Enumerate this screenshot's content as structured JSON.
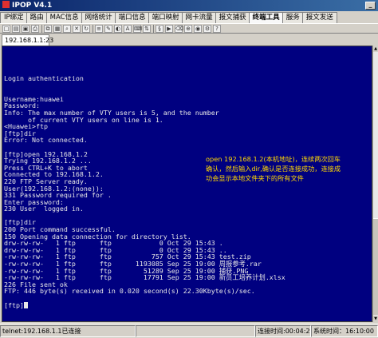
{
  "window": {
    "title": "IPOP V4.1"
  },
  "tabs": [
    {
      "label": "IP绑定"
    },
    {
      "label": "路由"
    },
    {
      "label": "MAC信息"
    },
    {
      "label": "网络统计"
    },
    {
      "label": "端口信息"
    },
    {
      "label": "端口映射"
    },
    {
      "label": "网卡流量"
    },
    {
      "label": "报文捕获"
    },
    {
      "label": "终端工具"
    },
    {
      "label": "服务"
    },
    {
      "label": "报文发送"
    }
  ],
  "toolbar": {
    "icons": [
      "new-session-icon",
      "open-icon",
      "save-icon",
      "print-icon",
      "copy-icon",
      "paste-icon",
      "find-icon",
      "disconnect-icon",
      "reconnect-icon",
      "properties-icon",
      "log-icon",
      "color-icon",
      "font-icon",
      "keymap-icon",
      "transfer-icon",
      "script-icon",
      "macro-icon",
      "clear-icon",
      "zoom-icon",
      "capture-icon",
      "options-icon",
      "help-icon"
    ]
  },
  "session": {
    "tab_label": "192.168.1.1:23"
  },
  "terminal": {
    "lines": [
      "Login authentication",
      "",
      "",
      "Username:huawei",
      "Password:",
      "Info: The max number of VTY users is 5, and the number",
      "      of current VTY users on line is 1.",
      "<Huawei>ftp",
      "[ftp]dir",
      "Error: Not connected.",
      "",
      "[ftp]open 192.168.1.2",
      "Trying 192.168.1.2 ...",
      "Press CTRL+K to abort",
      "Connected to 192.168.1.2.",
      "220 FTP Server ready.",
      "User(192.168.1.2:(none)):",
      "331 Password required for .",
      "Enter password:",
      "230 User  logged in.",
      "",
      "[ftp]dir",
      "200 Port command successful.",
      "150 Opening data connection for directory list.",
      "drw-rw-rw-   1 ftp      ftp            0 Oct 29 15:43 .",
      "drw-rw-rw-   1 ftp      ftp            0 Oct 29 15:43 ..",
      "-rw-rw-rw-   1 ftp      ftp          757 Oct 29 15:43 test.zip",
      "-rw-rw-rw-   1 ftp      ftp      1193085 Sep 25 19:00 周报参考.rar",
      "-rw-rw-rw-   1 ftp      ftp        51289 Sep 25 19:00 捕获.PNG",
      "-rw-rw-rw-   1 ftp      ftp        17791 Sep 25 19:00 新员工培养计划.xlsx",
      "226 File sent ok",
      "FTP: 446 byte(s) received in 0.020 second(s) 22.30Kbyte(s)/sec.",
      "",
      "[ftp]"
    ],
    "annotation": "open 192.168.1.2(本机地址)，连续两次回车确认，然后输入dir,确认是否连接成功，连接成功会显示本地文件夹下的所有文件"
  },
  "statusbar": {
    "connection": "telnet:192.168.1.1已连接",
    "connect_time": "连接时间:00:04:23",
    "system_time": "系统时间：16:10:00"
  }
}
